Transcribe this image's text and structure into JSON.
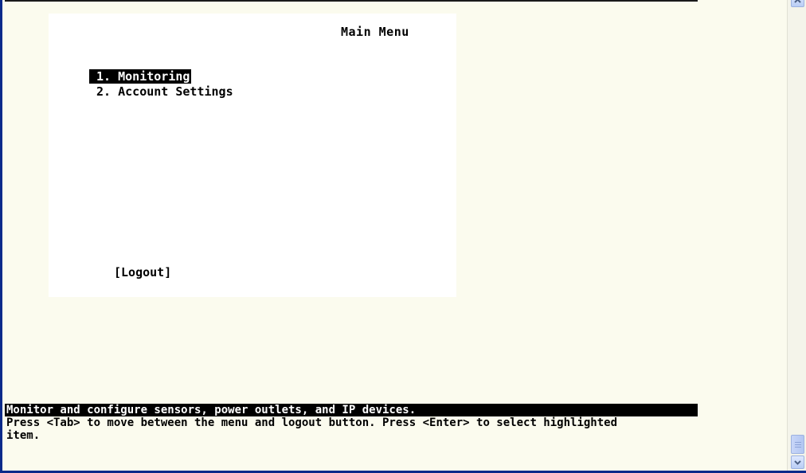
{
  "menu": {
    "title": "Main Menu",
    "items": [
      {
        "label": " 1. Monitoring",
        "selected": true
      },
      {
        "label": " 2. Account Settings",
        "selected": false
      }
    ],
    "logout_label": "[Logout]"
  },
  "status": {
    "description": "Monitor and configure sensors, power outlets, and IP devices.",
    "help": "Press <Tab> to move between the menu and logout button. Press <Enter> to select highlighted item."
  },
  "colors": {
    "terminal_bg": "#fbfbee",
    "panel_bg": "#ffffff",
    "highlight_bg": "#000000",
    "highlight_fg": "#ffffff",
    "window_border": "#0a2a8a"
  },
  "icons": {
    "scroll_up": "chevron-up-icon",
    "scroll_down": "chevron-down-icon"
  }
}
